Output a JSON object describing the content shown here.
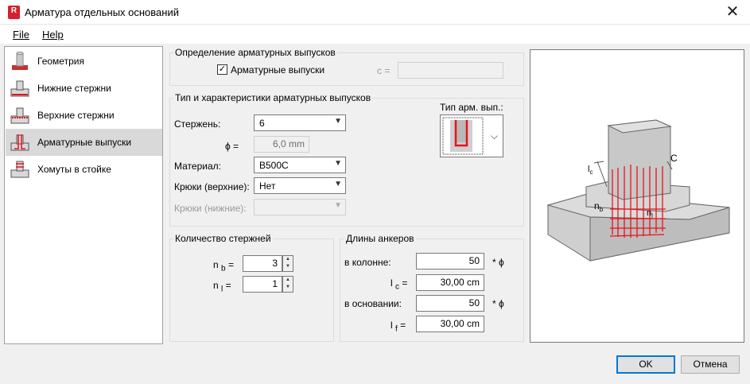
{
  "window": {
    "title": "Арматура отдельных оснований",
    "app_icon_letter": "R"
  },
  "menu": {
    "file": "File",
    "help": "Help"
  },
  "sidebar": {
    "items": [
      {
        "label": "Геометрия",
        "icon": "geometry-icon"
      },
      {
        "label": "Нижние стержни",
        "icon": "bottom-bars-icon"
      },
      {
        "label": "Верхние стержни",
        "icon": "top-bars-icon"
      },
      {
        "label": "Арматурные выпуски",
        "icon": "dowels-icon",
        "active": true
      },
      {
        "label": "Хомуты в стойке",
        "icon": "stirrups-icon"
      }
    ]
  },
  "definition": {
    "title": "Определение арматурных выпусков",
    "checkbox_label": "Арматурные выпуски",
    "checked": true,
    "c_label": "c =",
    "c_value": ""
  },
  "type": {
    "title": "Тип и характеристики арматурных выпусков",
    "bar_label": "Стержень:",
    "bar_value": "6",
    "phi_label": "ϕ =",
    "phi_value": "6,0 mm",
    "material_label": "Материал:",
    "material_value": "B500C",
    "hooks_top_label": "Крюки (верхние):",
    "hooks_top_value": "Нет",
    "hooks_bottom_label": "Крюки (нижние):",
    "hooks_bottom_value": "",
    "type_label": "Тип арм. вып.:"
  },
  "count": {
    "title": "Количество стержней",
    "nb_label": "n",
    "nb_sub": "b",
    "nb_eq": "=",
    "nb_value": "3",
    "nl_label": "n",
    "nl_sub": "l",
    "nl_eq": "=",
    "nl_value": "1"
  },
  "anchor": {
    "title": "Длины анкеров",
    "column_label": "в колонне:",
    "column_value": "50",
    "column_unit": "*  ϕ",
    "lc_label": "l",
    "lc_sub": "c",
    "lc_eq": "=",
    "lc_value": "30,00 cm",
    "base_label": "в основании:",
    "base_value": "50",
    "base_unit": "*  ϕ",
    "lf_label": "l",
    "lf_sub": "f",
    "lf_eq": "=",
    "lf_value": "30,00 cm"
  },
  "preview": {
    "lc": "l",
    "lc_sub": "c",
    "c": "C",
    "nb": "n",
    "nb_sub": "b",
    "nl": "n",
    "nl_sub": "l"
  },
  "buttons": {
    "ok": "OK",
    "cancel": "Отмена"
  },
  "colors": {
    "accent": "#0078d7",
    "rebar": "#e8131b",
    "brand": "#d61f2c"
  }
}
